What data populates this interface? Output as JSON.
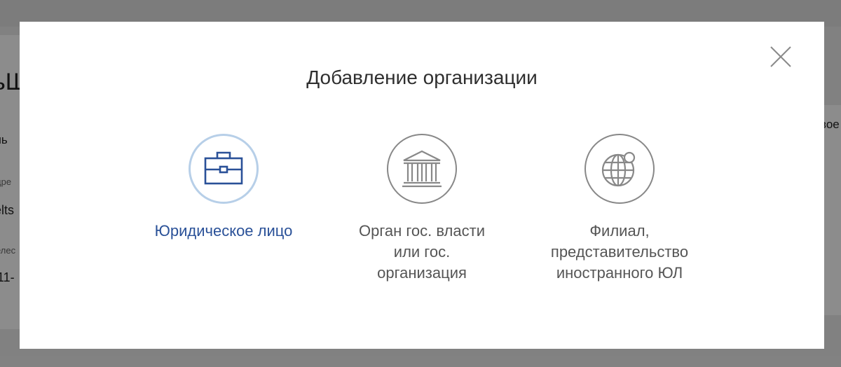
{
  "background": {
    "fragments": [
      "ьШ",
      "ль",
      "дре",
      "elts",
      "елес",
      "11-",
      "вое"
    ]
  },
  "modal": {
    "title": "Добавление организации",
    "close_icon": "close-icon",
    "options": [
      {
        "label_lines": [
          "Юридическое лицо"
        ],
        "icon": "briefcase-icon",
        "selected": true
      },
      {
        "label_lines": [
          "Орган гос. власти",
          "или гос.",
          "организация"
        ],
        "icon": "government-building-icon",
        "selected": false
      },
      {
        "label_lines": [
          "Филиал,",
          "представительство",
          "иностранного ЮЛ"
        ],
        "icon": "globe-icon",
        "selected": false
      }
    ]
  },
  "colors": {
    "accent": "#2a5198",
    "selected_ring": "#b7cfe8",
    "icon_gray": "#888888",
    "title": "#2f2f2f"
  }
}
